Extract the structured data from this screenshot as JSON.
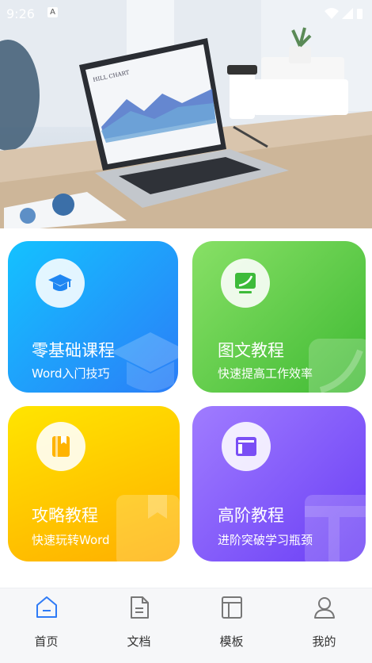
{
  "status_bar": {
    "time": "9:26",
    "notification_icon": "a-icon"
  },
  "hero": {
    "image": "laptop-desk-photo",
    "screen_title": "HILL CHART"
  },
  "cards": [
    {
      "title": "零基础课程",
      "subtitle": "Word入门技巧",
      "icon": "graduation-cap-icon",
      "gradient": [
        "#1ab9ff",
        "#2e7bf6"
      ]
    },
    {
      "title": "图文教程",
      "subtitle": "快速提高工作效率",
      "icon": "monitor-icon",
      "gradient": [
        "#7fdc5a",
        "#3fbb36"
      ]
    },
    {
      "title": "攻略教程",
      "subtitle": "快速玩转Word",
      "icon": "book-icon",
      "gradient": [
        "#ffd400",
        "#ffae00"
      ]
    },
    {
      "title": "高阶教程",
      "subtitle": "进阶突破学习瓶颈",
      "icon": "layout-icon",
      "gradient": [
        "#9a73ff",
        "#6a3ef5"
      ]
    }
  ],
  "tabbar": {
    "items": [
      {
        "label": "首页",
        "icon": "home-icon",
        "active": true
      },
      {
        "label": "文档",
        "icon": "document-icon",
        "active": false
      },
      {
        "label": "模板",
        "icon": "template-icon",
        "active": false
      },
      {
        "label": "我的",
        "icon": "user-icon",
        "active": false
      }
    ],
    "active_color": "#2f7bf6"
  }
}
